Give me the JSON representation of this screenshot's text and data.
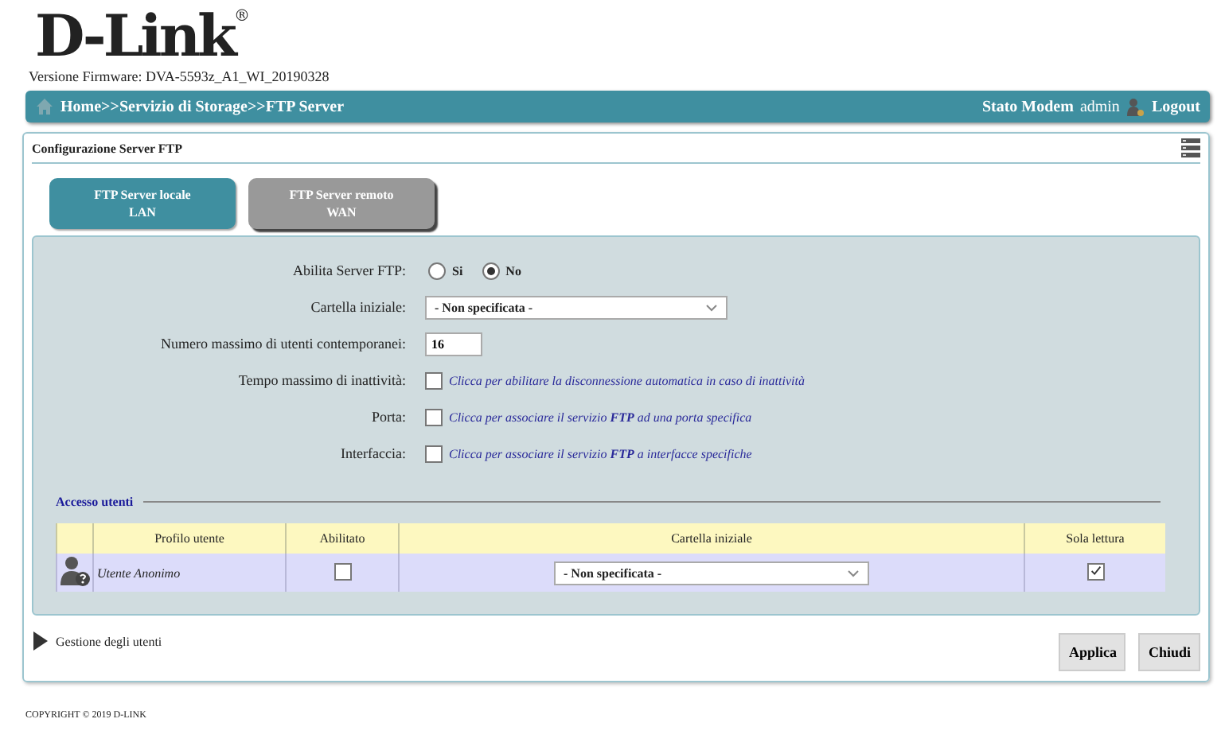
{
  "logo": "D-Link",
  "logo_mark": "®",
  "firmware": "Versione Firmware: DVA-5593z_A1_WI_20190328",
  "breadcrumb": "Home>>Servizio di Storage>>FTP Server",
  "nav_right": {
    "status": "Stato Modem",
    "user": "admin",
    "logout": "Logout"
  },
  "panel": {
    "title": "Configurazione Server FTP"
  },
  "tabs": [
    {
      "line1": "FTP Server locale",
      "line2": "LAN",
      "selected": true
    },
    {
      "line1": "FTP Server remoto",
      "line2": "WAN",
      "selected": false
    }
  ],
  "form": [
    {
      "kind": "radio",
      "label": "Abilita Server FTP:",
      "options": [
        {
          "label": "Si",
          "selected": false
        },
        {
          "label": "No",
          "selected": true
        }
      ]
    },
    {
      "kind": "select",
      "label": "Cartella iniziale:",
      "value": "- Non specificata -"
    },
    {
      "kind": "input",
      "label": "Numero massimo di utenti contemporanei:",
      "value": "16"
    },
    {
      "kind": "check",
      "label": "Tempo massimo di inattività:",
      "checked": false,
      "text": "Clicca per abilitare la disconnessione automatica in caso di inattività"
    },
    {
      "kind": "check",
      "label": "Porta:",
      "checked": false,
      "text": "Clicca per associare il servizio **FTP** ad una porta specifica"
    },
    {
      "kind": "check",
      "label": "Interfaccia:",
      "checked": false,
      "text": "Clicca per associare il servizio **FTP** a interfacce specifiche"
    }
  ],
  "access": {
    "title": "Accesso utenti",
    "columns": [
      "Profilo utente",
      "Abilitato",
      "Cartella iniziale",
      "Sola lettura"
    ],
    "rows": [
      {
        "profile": "Utente Anonimo",
        "enabled": false,
        "folder": "- Non specificata -",
        "read_only": true
      }
    ]
  },
  "expander": {
    "label": "Gestione degli utenti",
    "expanded": false
  },
  "buttons": [
    "Applica",
    "Chiudi"
  ],
  "copyright": "COPYRIGHT © 2019 D-LINK"
}
